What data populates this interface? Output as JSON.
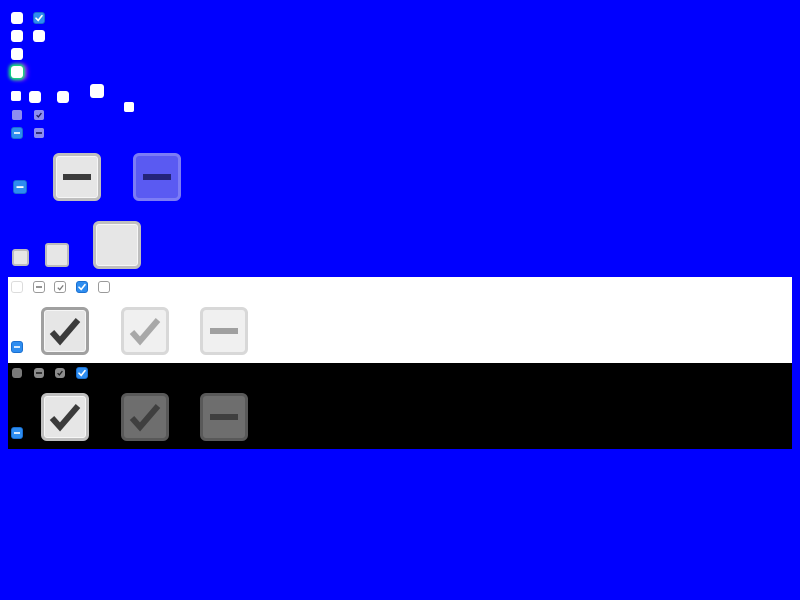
{
  "colors": {
    "background": "#0000ff",
    "accent": "#2e8df0",
    "panel_light": "#ffffff",
    "panel_dark": "#000000"
  },
  "rows": {
    "blue_area": {
      "row1": [
        "unchecked",
        "checked"
      ],
      "row2": [
        "unchecked",
        "unchecked"
      ],
      "row3": [
        "unchecked"
      ],
      "row4": [
        "focused"
      ],
      "row5": [
        "unchecked",
        "unchecked",
        "unchecked",
        "unchecked",
        "unchecked"
      ],
      "row6": [
        "disabled-unchecked",
        "disabled-checked"
      ],
      "row7": [
        "mixed",
        "disabled-mixed"
      ],
      "large_row": [
        "mixed",
        "mixed-large",
        "mixed-large-disabled"
      ],
      "size_row": [
        "unchecked-small",
        "unchecked-medium",
        "unchecked-large"
      ]
    },
    "light_panel": {
      "small": [
        "disabled-unchecked",
        "disabled-mixed",
        "disabled-checked",
        "checked",
        "unchecked"
      ],
      "large": [
        "checked",
        "disabled-checked",
        "disabled-mixed"
      ],
      "extra": [
        "mixed"
      ]
    },
    "dark_panel": {
      "small": [
        "disabled-unchecked",
        "disabled-mixed",
        "disabled-checked",
        "checked"
      ],
      "large": [
        "checked",
        "disabled-checked",
        "disabled-mixed"
      ],
      "extra": [
        "mixed"
      ]
    }
  },
  "icons": {
    "check": "check-icon",
    "mixed": "dash-icon"
  }
}
